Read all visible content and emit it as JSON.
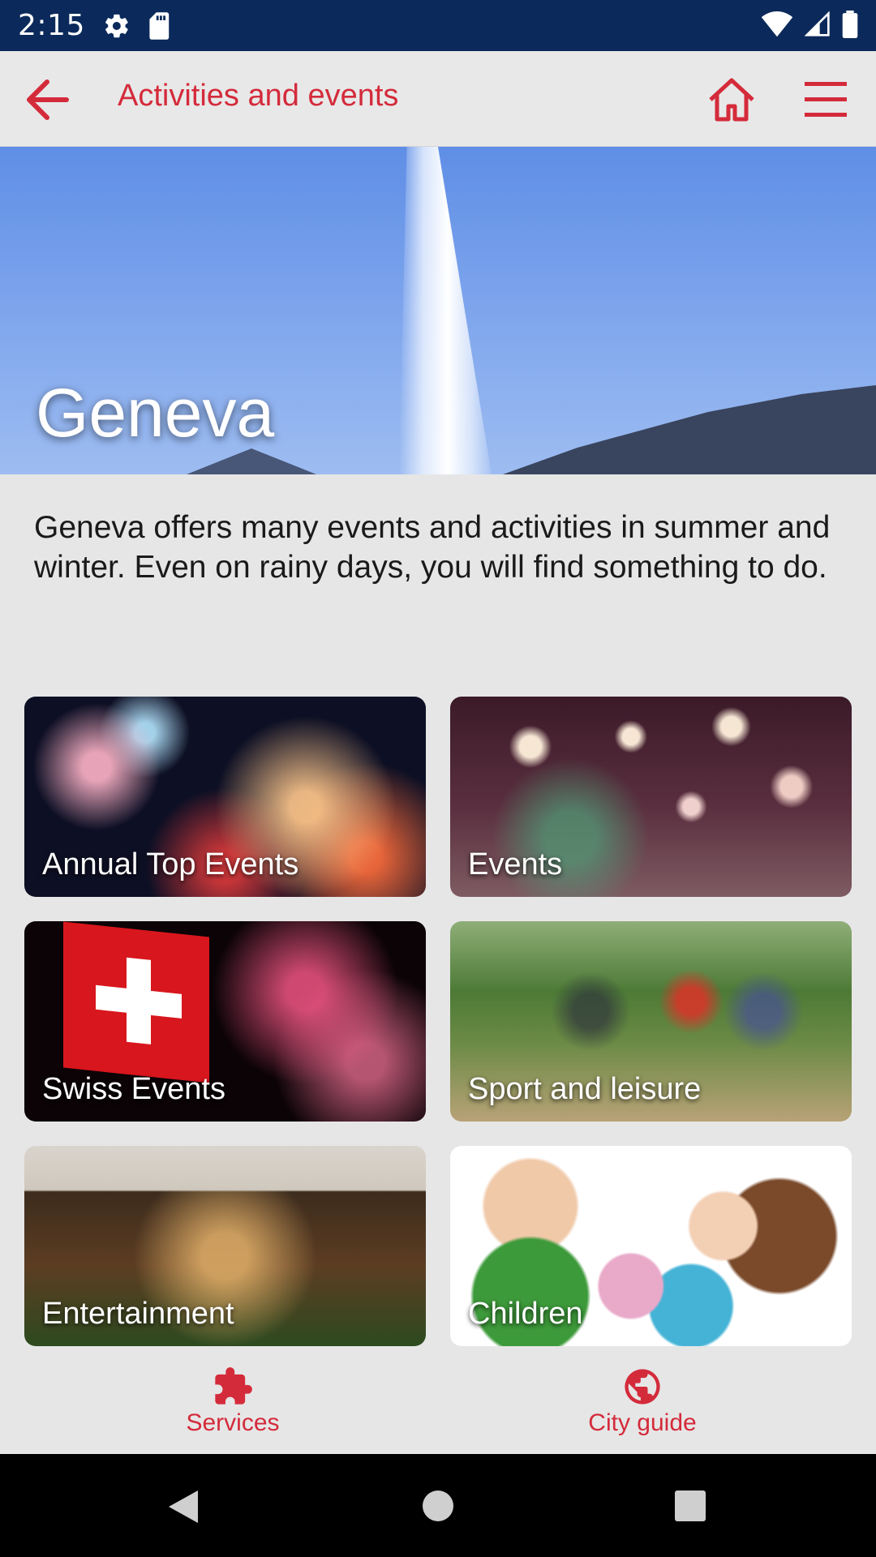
{
  "status_bar": {
    "time": "2:15",
    "icons": [
      "settings-icon",
      "sd-card-icon",
      "wifi-icon",
      "signal-icon",
      "battery-icon"
    ]
  },
  "app_bar": {
    "title": "Activities and events",
    "icons": [
      "back-arrow-icon",
      "home-icon",
      "hamburger-menu-icon"
    ],
    "accent_color": "#d42b3b"
  },
  "hero": {
    "title": "Geneva"
  },
  "intro": {
    "text": "Geneva offers many events and activities in summer and winter. Even on rainy days, you will find something to do."
  },
  "tiles": [
    {
      "label": "Annual Top Events"
    },
    {
      "label": "Events"
    },
    {
      "label": "Swiss Events"
    },
    {
      "label": "Sport and leisure"
    },
    {
      "label": "Entertainment"
    },
    {
      "label": "Children"
    }
  ],
  "bottom_nav": {
    "items": [
      {
        "label": "Services",
        "icon": "puzzle-icon"
      },
      {
        "label": "City guide",
        "icon": "globe-icon"
      }
    ]
  },
  "system_nav": {
    "icons": [
      "back-triangle-icon",
      "home-circle-icon",
      "recents-square-icon"
    ]
  }
}
